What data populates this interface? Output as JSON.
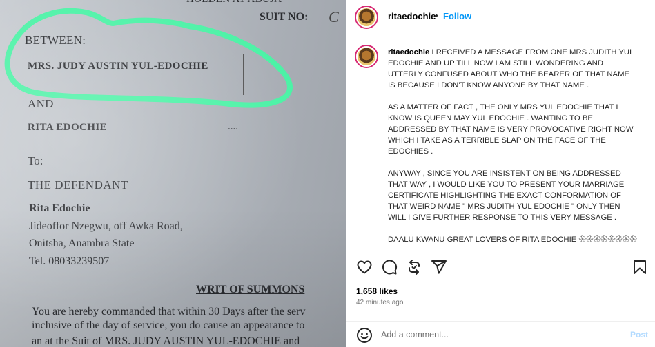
{
  "photo": {
    "header_text": "HOLDEN AT ABUJA",
    "suit_label": "SUIT NO:",
    "suit_value": "C",
    "between": "BETWEEN:",
    "plaintiff": "MRS.  JUDY AUSTIN YUL-EDOCHIE",
    "and": "AND",
    "defendant": "RITA EDOCHIE",
    "dots": "....",
    "to": "To:",
    "the_defendant": "THE DEFENDANT",
    "address_name": "Rita Edochie",
    "address_line1": "Jideoffor Nzegwu, off Awka Road,",
    "address_line2": "Onitsha, Anambra State",
    "address_tel": "Tel. 08033239507",
    "writ_title": "WRIT OF SUMMONS",
    "body_line1": "You are hereby commanded that within 30 Days after the serv",
    "body_line2": "inclusive of the day of service, you do cause an appearance to",
    "body_line3": "an at the Suit of MRS.  JUDY AUSTIN YUL-EDOCHIE and"
  },
  "header": {
    "username": "ritaedochie",
    "separator": "•",
    "follow_label": "Follow"
  },
  "caption": {
    "username": "ritaedochie",
    "paragraphs": [
      "I RECEIVED A MESSAGE FROM ONE MRS JUDITH YUL EDOCHIE AND UP TILL NOW I AM STILL WONDERING AND UTTERLY CONFUSED ABOUT WHO THE BEARER OF THAT NAME IS BECAUSE I DON'T KNOW ANYONE BY THAT NAME .",
      "AS A MATTER OF FACT , THE ONLY MRS YUL EDOCHIE THAT I KNOW IS QUEEN MAY YUL EDOCHIE . WANTING TO BE ADDRESSED BY THAT NAME IS VERY PROVOCATIVE RIGHT NOW WHICH I TAKE AS A TERRIBLE SLAP ON THE FACE OF THE EDOCHIES .",
      "ANYWAY , SINCE YOU ARE INSISTENT ON BEING ADDRESSED THAT WAY , I WOULD LIKE YOU TO PRESENT YOUR MARRIAGE CERTIFICATE HIGHLIGHTING THE EXACT CONFORMATION OF THAT WEIRD NAME \" MRS JUDITH YUL EDOCHIE \" ONLY THEN WILL I GIVE FURTHER RESPONSE TO THIS VERY MESSAGE .",
      "DAALU KWANU GREAT LOVERS OF RITA EDOCHIE 𑁍𑁍𑁍𑁍𑁍𑁍𑁍𑁍𑁍"
    ]
  },
  "actions": {
    "like_icon": "heart-icon",
    "comment_icon": "comment-icon",
    "share_icon": "repost-icon",
    "send_icon": "send-icon",
    "save_icon": "bookmark-icon",
    "likes_text": "1,658 likes",
    "time_text": "42 minutes ago"
  },
  "comment": {
    "placeholder": "Add a comment...",
    "post_label": "Post",
    "emoji_icon": "smile-icon"
  },
  "colors": {
    "link_blue": "#0095f6",
    "post_disabled": "#b3dbff",
    "highlight_green": "#4cf2a6"
  }
}
